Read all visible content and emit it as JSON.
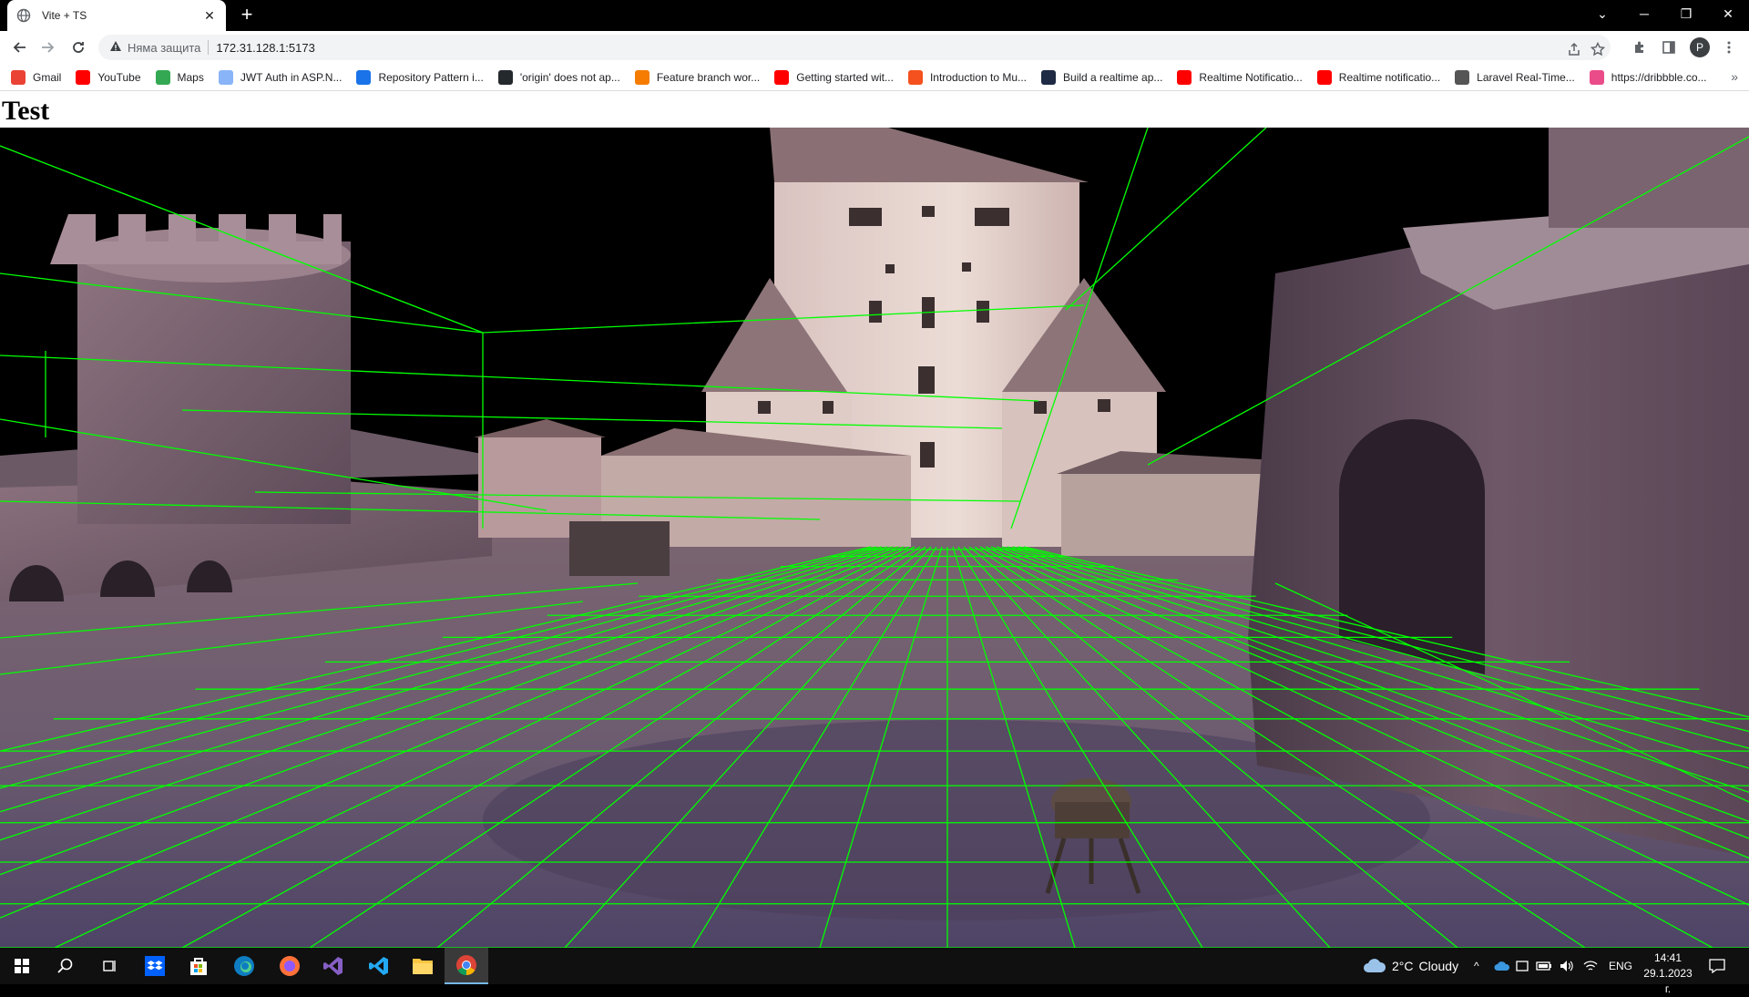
{
  "browser": {
    "tab": {
      "title": "Vite + TS",
      "favicon": "globe-icon"
    },
    "address": {
      "security_label": "Няма защита",
      "url": "172.31.128.1:5173"
    },
    "bookmarks": [
      {
        "label": "Gmail",
        "icon": "gmail-icon",
        "color": "#ea4335"
      },
      {
        "label": "YouTube",
        "icon": "youtube-icon",
        "color": "#ff0000"
      },
      {
        "label": "Maps",
        "icon": "maps-icon",
        "color": "#34a853"
      },
      {
        "label": "JWT Auth in ASP.N...",
        "icon": "jwt-icon",
        "color": "#8ab4f8"
      },
      {
        "label": "Repository Pattern i...",
        "icon": "medium-icon",
        "color": "#1a73e8"
      },
      {
        "label": "'origin' does not ap...",
        "icon": "github-icon",
        "color": "#24292e"
      },
      {
        "label": "Feature branch wor...",
        "icon": "atlassian-icon",
        "color": "#f57c00"
      },
      {
        "label": "Getting started wit...",
        "icon": "youtube-icon",
        "color": "#ff0000"
      },
      {
        "label": "Introduction to Mu...",
        "icon": "bookmark-a-icon",
        "color": "#f4511e"
      },
      {
        "label": "Build a realtime ap...",
        "icon": "dark-doc-icon",
        "color": "#1f2a44"
      },
      {
        "label": "Realtime Notificatio...",
        "icon": "youtube-icon",
        "color": "#ff0000"
      },
      {
        "label": "Realtime notificatio...",
        "icon": "youtube-icon",
        "color": "#ff0000"
      },
      {
        "label": "Laravel Real-Time...",
        "icon": "laravel-icon",
        "color": "#555555"
      },
      {
        "label": "https://dribbble.co...",
        "icon": "dribbble-icon",
        "color": "#ea4c89"
      }
    ],
    "profile_initial": "P"
  },
  "page": {
    "heading": "Test",
    "scene": {
      "description_icon": "3d-scene",
      "wireframe_color": "#00ff00"
    }
  },
  "taskbar": {
    "apps": [
      {
        "name": "start-icon"
      },
      {
        "name": "search-icon"
      },
      {
        "name": "task-view-icon"
      },
      {
        "name": "dropbox-icon"
      },
      {
        "name": "store-icon"
      },
      {
        "name": "edge-icon"
      },
      {
        "name": "firefox-icon"
      },
      {
        "name": "visual-studio-icon"
      },
      {
        "name": "vscode-icon"
      },
      {
        "name": "file-explorer-icon"
      },
      {
        "name": "chrome-icon"
      }
    ],
    "weather": {
      "temp": "2°C",
      "condition": "Cloudy"
    },
    "language": "ENG",
    "time": "14:41",
    "date": "29.1.2023 г."
  }
}
